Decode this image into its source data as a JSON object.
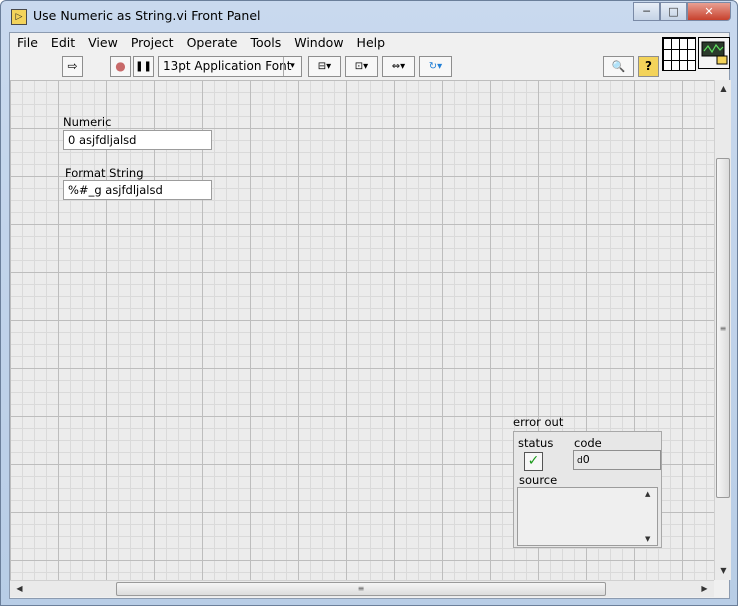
{
  "window": {
    "title": "Use Numeric as String.vi Front Panel",
    "app_icon": "labview-vi-icon",
    "controls": {
      "minimize": "─",
      "maximize": "□",
      "close": "✕"
    }
  },
  "menu": [
    "File",
    "Edit",
    "View",
    "Project",
    "Operate",
    "Tools",
    "Window",
    "Help"
  ],
  "toolbar": {
    "run_icon": "⇨",
    "abort_icon": "●",
    "pause_icon": "❚❚",
    "font_label": "13pt Application Font",
    "font_arrow": "▾",
    "align_icon": "⊟▾",
    "distribute_icon": "⊡▾",
    "resize_icon": "⇔▾",
    "reorder_icon": "↻▾",
    "search_icon": "🔍",
    "help_icon": "?"
  },
  "front_panel": {
    "numeric": {
      "label": "Numeric",
      "value": "0 asjfdljalsd"
    },
    "format_string": {
      "label": "Format String",
      "value": "%#_g asjfdljalsd"
    },
    "error_out": {
      "label": "error out",
      "status_label": "status",
      "status_mark": "✓",
      "code_label": "code",
      "code_value": "0",
      "code_prefix": "d",
      "source_label": "source"
    }
  },
  "scrollbars": {
    "up": "▲",
    "down": "▼",
    "left": "◀",
    "right": "▶",
    "grip": "≡"
  }
}
